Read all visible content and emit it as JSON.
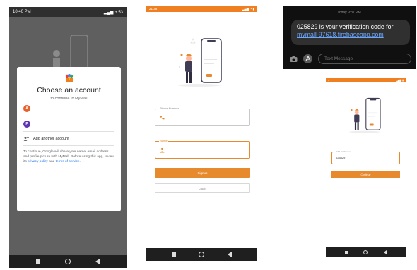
{
  "phone1": {
    "status_time": "10:40 PM",
    "status_right": "53",
    "dialog": {
      "title": "Choose an account",
      "subtitle": "to continue to MyMall",
      "accounts": [
        {
          "initial": "A",
          "color": "#e8622c"
        },
        {
          "initial": "P",
          "color": "#5e35b1"
        }
      ],
      "add_account": "Add another account",
      "disclaimer_text": "To continue, Google will share your name, email address and profile picture with MyMall. Before using this app, review its",
      "privacy_label": "privacy policy",
      "and_label": "and",
      "terms_label": "terms of service",
      "period": "."
    }
  },
  "phone2": {
    "status_time": "21:36",
    "phone_label": "Phone Number",
    "name_label": "Name",
    "signup_label": "Signup",
    "login_label": "Login"
  },
  "sms": {
    "timestamp": "Today 9:37 PM",
    "code": "025829",
    "message_rest": " is your verification code for",
    "url": "mymall-97618.firebaseapp.com",
    "input_placeholder": "Text Message"
  },
  "phone3": {
    "otp_label": "OTP Verification",
    "otp_value": "025829",
    "verify_label": "Continue"
  },
  "colors": {
    "accent": "#e7892d",
    "status_bar": "#f07f22"
  }
}
